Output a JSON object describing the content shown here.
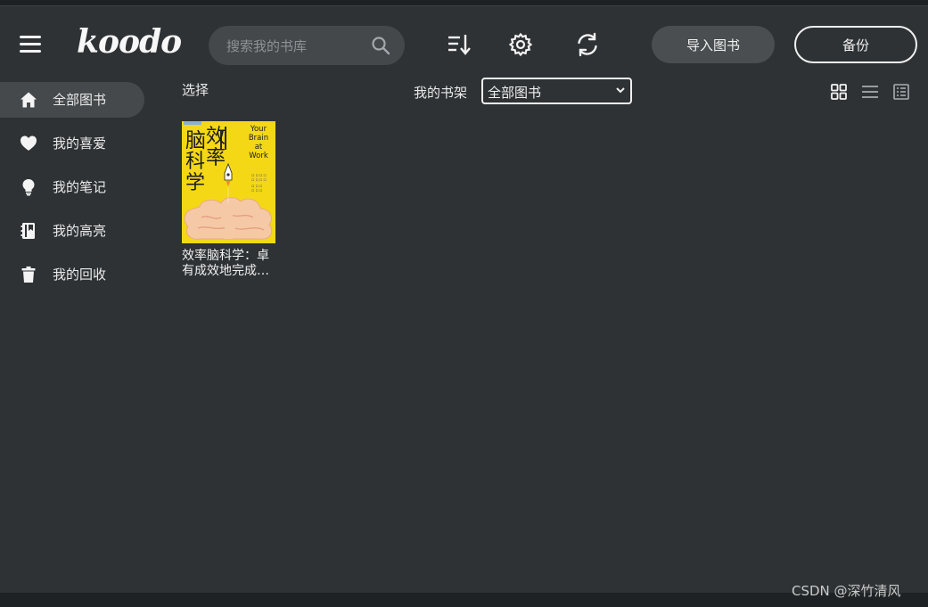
{
  "app": {
    "logo": "koodo"
  },
  "search": {
    "placeholder": "搜索我的书库"
  },
  "toolbar": {
    "sort_icon": "sort-icon",
    "settings_icon": "gear-icon",
    "sync_icon": "sync-icon",
    "import_label": "导入图书",
    "backup_label": "备份"
  },
  "sidebar": {
    "items": [
      {
        "label": "全部图书",
        "icon": "home-icon",
        "active": true
      },
      {
        "label": "我的喜爱",
        "icon": "heart-icon"
      },
      {
        "label": "我的笔记",
        "icon": "bulb-icon"
      },
      {
        "label": "我的高亮",
        "icon": "highlight-book-icon"
      },
      {
        "label": "我的回收",
        "icon": "trash-icon"
      }
    ]
  },
  "main": {
    "select_label": "选择",
    "shelf_label": "我的书架",
    "shelf_selected": "全部图书",
    "view_modes": [
      "grid-view-icon",
      "list-view-icon",
      "detail-view-icon"
    ]
  },
  "books": [
    {
      "title": "效率脑科学：卓有成效地完成…",
      "cover": {
        "cn_title_lines": [
          "效率",
          "脑",
          "科学"
        ],
        "en_title_lines": [
          "Your",
          "Brain",
          "at",
          "Work"
        ],
        "bg": "#f4d816",
        "brain": "#f6c9a6"
      }
    }
  ],
  "watermark": "CSDN @深竹清风",
  "colors": {
    "bg": "#2e3235",
    "panel": "#45494c",
    "text": "#e6e6e6",
    "accent_yellow": "#f4d816"
  }
}
